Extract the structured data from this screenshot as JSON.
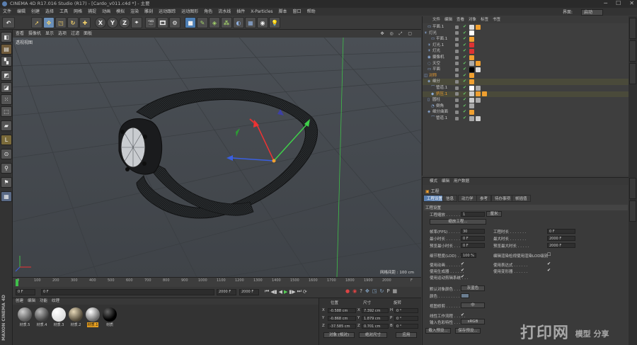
{
  "window": {
    "title": "CINEMA 4D R17.016 Studio (R17) - [Cardo_v011.c4d *] - 主要"
  },
  "menubar": {
    "items": [
      "文件",
      "编辑",
      "创建",
      "选择",
      "工具",
      "网格",
      "捕捉",
      "动画",
      "模拟",
      "渲染",
      "雕刻",
      "运动跟踪",
      "运动图形",
      "角色",
      "流水线",
      "插件",
      "X-Particles",
      "脚本",
      "窗口",
      "帮助"
    ],
    "interface_label": "界面:",
    "interface_value": "启动"
  },
  "toolbar": {
    "xyz": [
      "X",
      "Y",
      "Z"
    ]
  },
  "viewport": {
    "menu": [
      "查看",
      "摄像机",
      "显示",
      "选项",
      "过滤",
      "面板"
    ],
    "label": "透视视图",
    "scale": "网格间距 : 100 cm"
  },
  "timeline": {
    "ticks": [
      "0",
      "100",
      "200",
      "300",
      "400",
      "500",
      "600",
      "700",
      "800",
      "900",
      "1000",
      "1100",
      "1200",
      "1300",
      "1400",
      "1500",
      "1600",
      "1700",
      "1800",
      "1900",
      "2000"
    ],
    "unit": "F"
  },
  "playbar": {
    "start": "0 F",
    "current": "0 F",
    "end": "2000 F",
    "end2": "2000 F"
  },
  "material_manager": {
    "menu": [
      "创建",
      "编辑",
      "功能",
      "纹理"
    ],
    "materials": [
      {
        "name": "材质.5",
        "color": "#8a8a8a"
      },
      {
        "name": "材质.4",
        "color": "#6f6f6f"
      },
      {
        "name": "材质.3",
        "color": "#f0f0f0"
      },
      {
        "name": "材质.2",
        "color": "#9a8a70"
      },
      {
        "name": "材质.1",
        "color": "#c8c8c8"
      },
      {
        "name": "材质",
        "color": "#0c0c0c"
      }
    ]
  },
  "coords": {
    "headers": [
      "位置",
      "尺寸",
      "旋转"
    ],
    "rows": [
      {
        "axis": "X",
        "pos": "-0.588 cm",
        "size_axis": "X",
        "size": "7.392 cm",
        "rot_axis": "H",
        "rot": "0 °"
      },
      {
        "axis": "Y",
        "pos": "-0.868 cm",
        "size_axis": "Y",
        "size": "1.879 cm",
        "rot_axis": "P",
        "rot": "0 °"
      },
      {
        "axis": "Z",
        "pos": "-37.585 cm",
        "size_axis": "Z",
        "size": "0.701 cm",
        "rot_axis": "B",
        "rot": "0 °"
      }
    ],
    "mode": "对象 (相对)",
    "size_mode": "绝对尺寸",
    "apply": "应用"
  },
  "object_manager": {
    "menu": [
      "文件",
      "编辑",
      "查看",
      "对象",
      "标签",
      "书签"
    ],
    "objects": [
      {
        "name": "平面.1",
        "indent": 1
      },
      {
        "name": "灯光",
        "indent": 0
      },
      {
        "name": "平面.1",
        "indent": 2
      },
      {
        "name": "灯光.1",
        "indent": 1
      },
      {
        "name": "灯光",
        "indent": 1
      },
      {
        "name": "摄像机",
        "indent": 1
      },
      {
        "name": "天空",
        "indent": 1
      },
      {
        "name": "平面",
        "indent": 1
      },
      {
        "name": "对称",
        "indent": 0
      },
      {
        "name": "细分",
        "indent": 1
      },
      {
        "name": "管道.1",
        "indent": 2
      },
      {
        "name": "挤压.1",
        "indent": 2
      },
      {
        "name": "圆柱",
        "indent": 1
      },
      {
        "name": "倒角",
        "indent": 2
      },
      {
        "name": "细分曲面",
        "indent": 1
      },
      {
        "name": "管道.1",
        "indent": 2
      }
    ]
  },
  "attribute_manager": {
    "menu": [
      "模式",
      "编辑",
      "用户数据"
    ],
    "title": "工程",
    "tabs": [
      "工程设置",
      "信息",
      "动力学",
      "参考",
      "待办事项",
      "帧插值"
    ],
    "section": "工程设置",
    "scale_label": "工程缩放 . . . . . . .",
    "scale_value": "1",
    "scale_unit": "厘米",
    "scale_btn": "缩放工程...",
    "fps_label": "帧率(FPS) . . . . . . .",
    "fps": "30",
    "project_time_label": "工程时长 . . . . . . .",
    "project_time": "0 F",
    "min_time_label": "最小时长 . . . . . . .",
    "min_time": "0 F",
    "max_time_label": "最大时长 . . . . . . .",
    "max_time": "2000 F",
    "preview_min_label": "预览最小时长 . . . . .",
    "preview_min": "0 F",
    "preview_max_label": "预览最大时长 . . . . .",
    "preview_max": "2000 F",
    "lod_label": "细节程度(LOD) . . . . .",
    "lod": "100 %",
    "render_lod_label": "编辑渲染检视使用渲染LOD级别",
    "use_anim": "使用动画 . . . . . . .",
    "use_expr": "使用表达式 . . . . . .",
    "use_gen": "使用生成器 . . . . . .",
    "use_deform": "使用变形器 . . . . . .",
    "use_motion": "使用运动剪辑系统 . . .",
    "default_color_label": "默认对象颜色 . . . . .",
    "default_color": "灰蓝色",
    "color_label": "颜色 . . . . . . . . .",
    "view_correction_label": "视图修剪 . . . . . . .",
    "view_correction": "中",
    "linear_label": "线性工作流程 . . . . .",
    "input_color_label": "输入色彩特性 . . . . .",
    "input_color": "sRGB",
    "load_preset": "载入预设...",
    "save_preset": "保存预设..."
  },
  "watermark": "打印网",
  "watermark_sub": "模型 分享"
}
